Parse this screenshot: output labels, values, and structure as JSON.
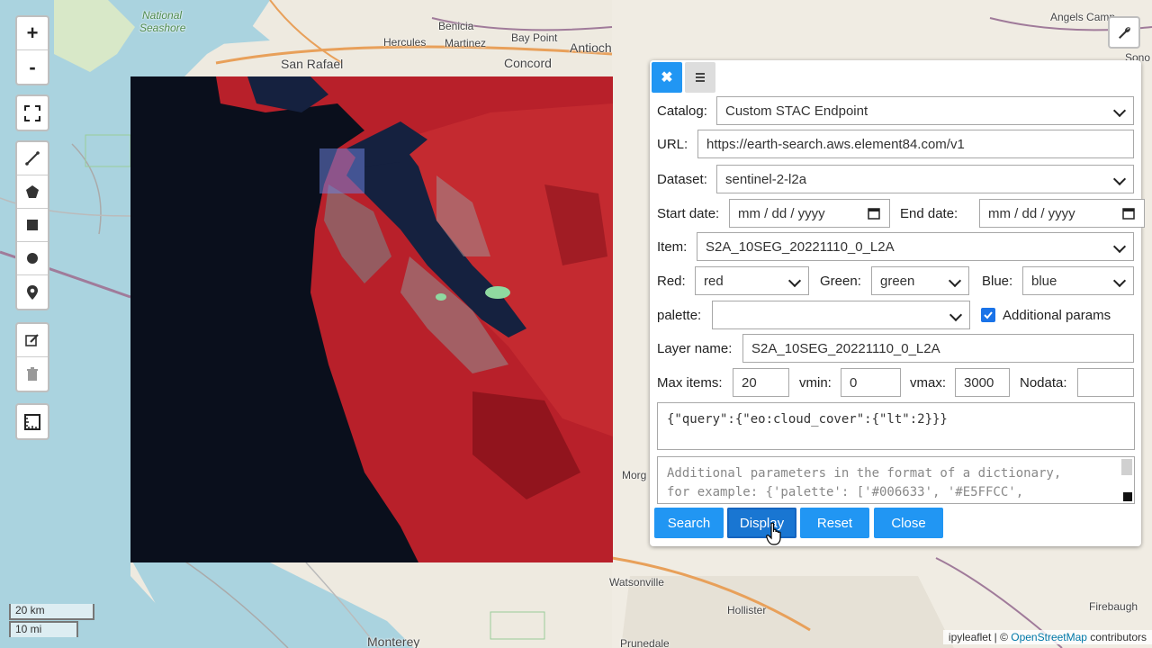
{
  "map": {
    "labels": {
      "national_seashore_1": "National",
      "national_seashore_2": "Seashore",
      "benicia": "Benicia",
      "hercules": "Hercules",
      "martinez": "Martinez",
      "bay_point": "Bay Point",
      "antioch": "Antioch",
      "angels_camp": "Angels Camp",
      "san_rafael": "San Rafael",
      "concord": "Concord",
      "sono": "Sono",
      "morgan": "Morg",
      "watsonville": "Watsonville",
      "hollister": "Hollister",
      "firebaugh": "Firebaugh",
      "monterey": "Monterey",
      "prunedale": "Prunedale"
    },
    "zoom_in": "+",
    "zoom_out": "-",
    "scale_km": "20 km",
    "scale_mi": "10 mi",
    "attribution_prefix": "ipyleaflet | © ",
    "attribution_link": "OpenStreetMap",
    "attribution_suffix": " contributors"
  },
  "panel": {
    "catalog_label": "Catalog:",
    "catalog_value": "Custom STAC Endpoint",
    "url_label": "URL:",
    "url_value": "https://earth-search.aws.element84.com/v1",
    "dataset_label": "Dataset:",
    "dataset_value": "sentinel-2-l2a",
    "start_date_label": "Start date:",
    "start_date_placeholder": "mm / dd / yyyy",
    "end_date_label": "End date:",
    "end_date_placeholder": "mm / dd / yyyy",
    "item_label": "Item:",
    "item_value": "S2A_10SEG_20221110_0_L2A",
    "red_label": "Red:",
    "red_value": "red",
    "green_label": "Green:",
    "green_value": "green",
    "blue_label": "Blue:",
    "blue_value": "blue",
    "palette_label": "palette:",
    "palette_value": "",
    "additional_params_label": "Additional params",
    "additional_params_checked": true,
    "layer_name_label": "Layer name:",
    "layer_name_value": "S2A_10SEG_20221110_0_L2A",
    "max_items_label": "Max items:",
    "max_items_value": "20",
    "vmin_label": "vmin:",
    "vmin_value": "0",
    "vmax_label": "vmax:",
    "vmax_value": "3000",
    "nodata_label": "Nodata:",
    "nodata_value": "",
    "query_text": "{\"query\":{\"eo:cloud_cover\":{\"lt\":2}}}",
    "params_placeholder_1": "Additional parameters in the format of a dictionary,",
    "params_placeholder_2": "for example: {'palette': ['#006633', '#E5FFCC',",
    "search_button": "Search",
    "display_button": "Display",
    "reset_button": "Reset",
    "close_button": "Close"
  }
}
